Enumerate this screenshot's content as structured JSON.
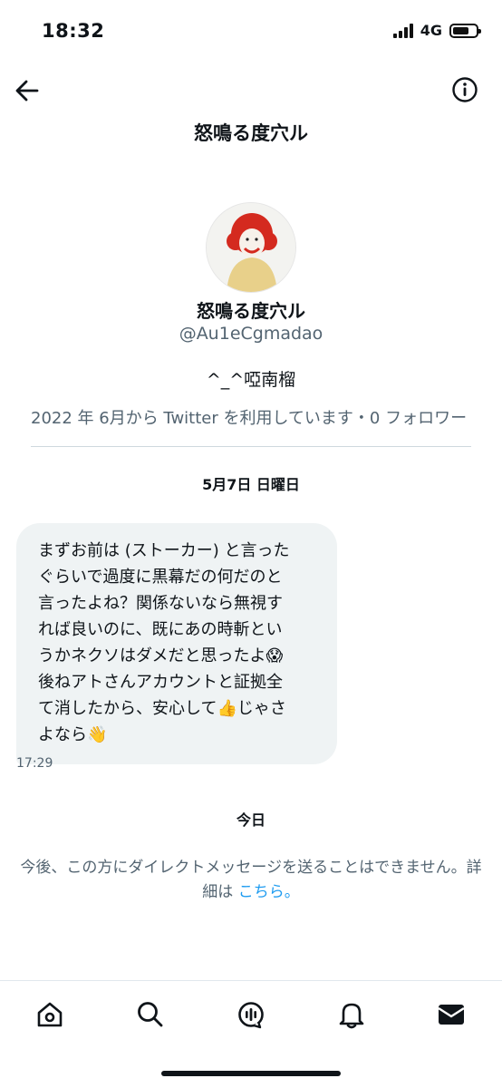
{
  "status": {
    "time": "18:32",
    "network": "4G"
  },
  "header": {
    "title": "怒鳴る度穴ル",
    "back_icon": "arrow-left-icon",
    "info_icon": "info-icon"
  },
  "profile": {
    "name": "怒鳴る度穴ル",
    "handle": "@Au1eCgmadao",
    "bio": "^_^啞南榴",
    "meta": "2022 年 6月から Twitter を利用しています・0 フォロワー"
  },
  "conversation": {
    "date1": "5月7日 日曜日",
    "message": {
      "lines": [
        "まずお前は (ストーカー) と言った",
        "ぐらいで過度に黒幕だの何だのと",
        "言ったよね？関係ないなら無視す",
        "れば良いのに、既にあの時斬とい",
        "うかネクソはダメだと思ったよ😱",
        "後ねアトさんアカウントと証拠全",
        "て消したから、安心して👍じゃさ",
        "よなら👋"
      ],
      "time": "17:29"
    },
    "date2": "今日",
    "notice_text": "今後、この方にダイレクトメッセージを送ることはできません。詳細は ",
    "notice_link": "こちら。"
  },
  "tabbar": {
    "icons": [
      "home-icon",
      "search-icon",
      "spaces-icon",
      "notifications-icon",
      "messages-icon"
    ]
  },
  "colors": {
    "accent": "#1d9bf0",
    "secondary_text": "#536471",
    "bubble_bg": "#eff3f4"
  }
}
